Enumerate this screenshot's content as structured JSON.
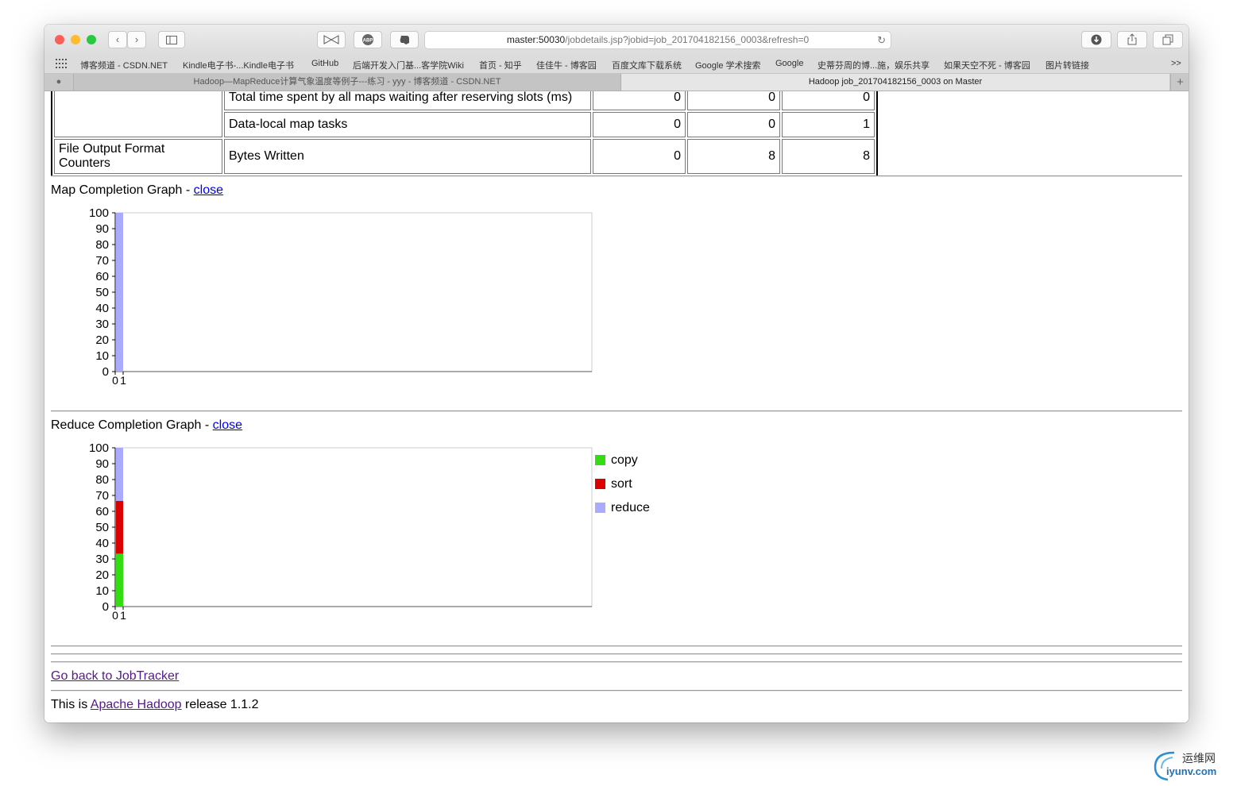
{
  "browser": {
    "url_host": "master:50030",
    "url_path": "/jobdetails.jsp?jobid=job_201704182156_0003&refresh=0",
    "bookmarks": [
      "博客频道 - CSDN.NET",
      "Kindle电子书-...Kindle电子书",
      "GitHub",
      "后端开发入门基...客学院Wiki",
      "首页 - 知乎",
      "佳佳牛 - 博客园",
      "百度文库下载系统",
      "Google 学术搜索",
      "Google",
      "史蒂芬周的博...施，娱乐共享",
      "如果天空不死 - 博客园",
      "图片转链接"
    ],
    "more": ">>",
    "tabs": [
      {
        "title": "Hadoop—MapReduce计算气象温度等例子---练习 - yyy - 博客频道 - CSDN.NET",
        "active": false
      },
      {
        "title": "Hadoop job_201704182156_0003 on Master",
        "active": true
      }
    ],
    "new_tab": "+"
  },
  "counters": {
    "rows": [
      {
        "group": "",
        "name": "Total time spent by all maps waiting after reserving slots (ms)",
        "map": "0",
        "reduce": "0",
        "total": "0"
      },
      {
        "group": "",
        "name": "Data-local map tasks",
        "map": "0",
        "reduce": "0",
        "total": "1"
      },
      {
        "group": "File Output Format Counters",
        "name": "Bytes Written",
        "map": "0",
        "reduce": "8",
        "total": "8"
      }
    ]
  },
  "map_graph": {
    "title": "Map Completion Graph - ",
    "close": "close "
  },
  "reduce_graph": {
    "title": "Reduce Completion Graph - ",
    "close": "close "
  },
  "chart_data": [
    {
      "type": "bar",
      "title": "Map Completion Graph",
      "categories": [
        "0"
      ],
      "x_ticks": [
        "0",
        "1"
      ],
      "series": [
        {
          "values": [
            100
          ],
          "color": "#aaaaff"
        }
      ],
      "ylim": [
        0,
        100
      ],
      "y_ticks": [
        0,
        10,
        20,
        30,
        40,
        50,
        60,
        70,
        80,
        90,
        100
      ]
    },
    {
      "type": "bar",
      "title": "Reduce Completion Graph",
      "stacked": true,
      "categories": [
        "0"
      ],
      "x_ticks": [
        "0",
        "1"
      ],
      "series": [
        {
          "name": "copy",
          "values": [
            33.3
          ],
          "color": "#33dd11"
        },
        {
          "name": "sort",
          "values": [
            33.3
          ],
          "color": "#dd0000"
        },
        {
          "name": "reduce",
          "values": [
            33.4
          ],
          "color": "#aaaaff"
        }
      ],
      "ylim": [
        0,
        100
      ],
      "y_ticks": [
        0,
        10,
        20,
        30,
        40,
        50,
        60,
        70,
        80,
        90,
        100
      ],
      "legend": "right"
    }
  ],
  "footer": {
    "back_link": "Go back to JobTracker",
    "release_prefix": "This is ",
    "release_link": "Apache Hadoop",
    "release_suffix": " release 1.1.2"
  },
  "watermark": {
    "cn": "运维网",
    "en": "iyunv.com"
  }
}
